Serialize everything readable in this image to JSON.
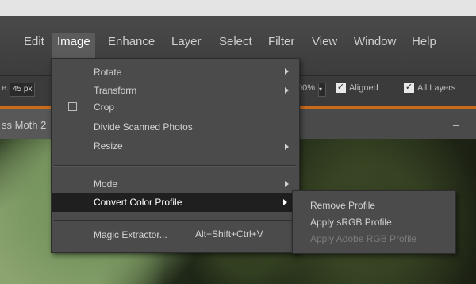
{
  "menubar": {
    "items": [
      {
        "label": "Edit"
      },
      {
        "label": "Image"
      },
      {
        "label": "Enhance"
      },
      {
        "label": "Layer"
      },
      {
        "label": "Select"
      },
      {
        "label": "Filter"
      },
      {
        "label": "View"
      },
      {
        "label": "Window"
      },
      {
        "label": "Help"
      }
    ],
    "active": "Image"
  },
  "options": {
    "size_label": "e:",
    "size_value": "45 px",
    "opacity_value": "00%",
    "aligned_label": "Aligned",
    "all_layers_label": "All Layers"
  },
  "document": {
    "title": "ss Moth 2",
    "minimize": "–"
  },
  "image_menu": {
    "items": [
      {
        "label": "Rotate",
        "submenu": true
      },
      {
        "label": "Transform",
        "submenu": true
      },
      {
        "label": "Crop",
        "icon": "crop-icon"
      },
      {
        "label": "Divide Scanned Photos"
      },
      {
        "label": "Resize",
        "submenu": true
      },
      {
        "label": "Mode",
        "submenu": true
      },
      {
        "label": "Convert Color Profile",
        "submenu": true,
        "highlighted": true
      },
      {
        "label": "Magic Extractor...",
        "shortcut": "Alt+Shift+Ctrl+V"
      }
    ]
  },
  "convert_submenu": {
    "items": [
      {
        "label": "Remove Profile",
        "enabled": true
      },
      {
        "label": "Apply sRGB Profile",
        "enabled": true
      },
      {
        "label": "Apply Adobe RGB Profile",
        "enabled": false
      }
    ]
  },
  "colors": {
    "menu_bg": "#4b4b4b",
    "highlight_bg": "#1f1f1f",
    "accent_orange": "#cc6a1c"
  }
}
